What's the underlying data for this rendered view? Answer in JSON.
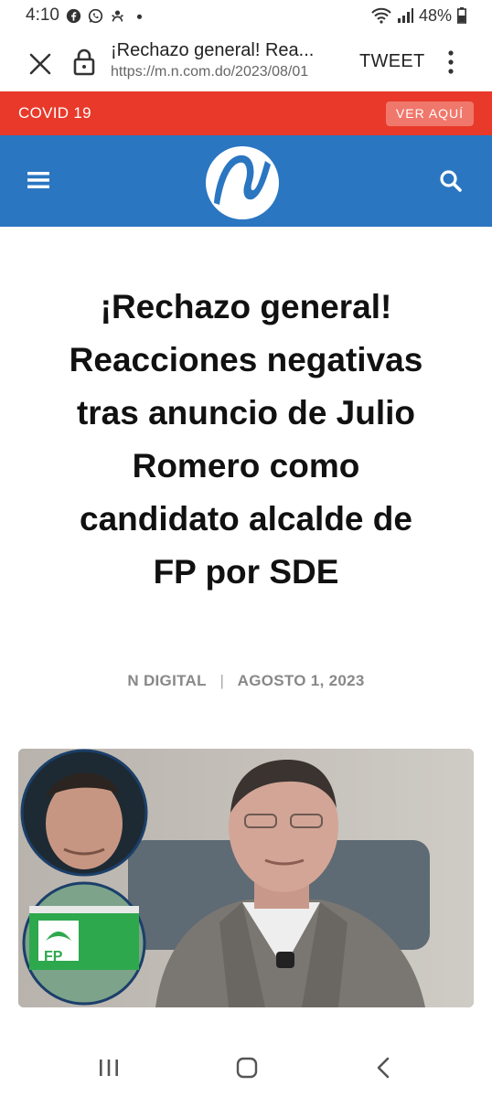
{
  "status_bar": {
    "time": "4:10",
    "battery": "48%"
  },
  "tab_bar": {
    "title": "¡Rechazo general! Rea...",
    "url": "https://m.n.com.do/2023/08/01",
    "tweet_label": "TWEET"
  },
  "banner": {
    "label": "COVID 19",
    "button_label": "VER AQUÍ"
  },
  "header": {
    "brand_color": "#2a76c1"
  },
  "article": {
    "title": "¡Rechazo general! Reacciones negativas tras anuncio de Julio Romero como candidato alcalde de FP por SDE",
    "author": "N DIGITAL",
    "separator": "|",
    "date": "AGOSTO 1, 2023",
    "image_caption_logo": "FP"
  }
}
